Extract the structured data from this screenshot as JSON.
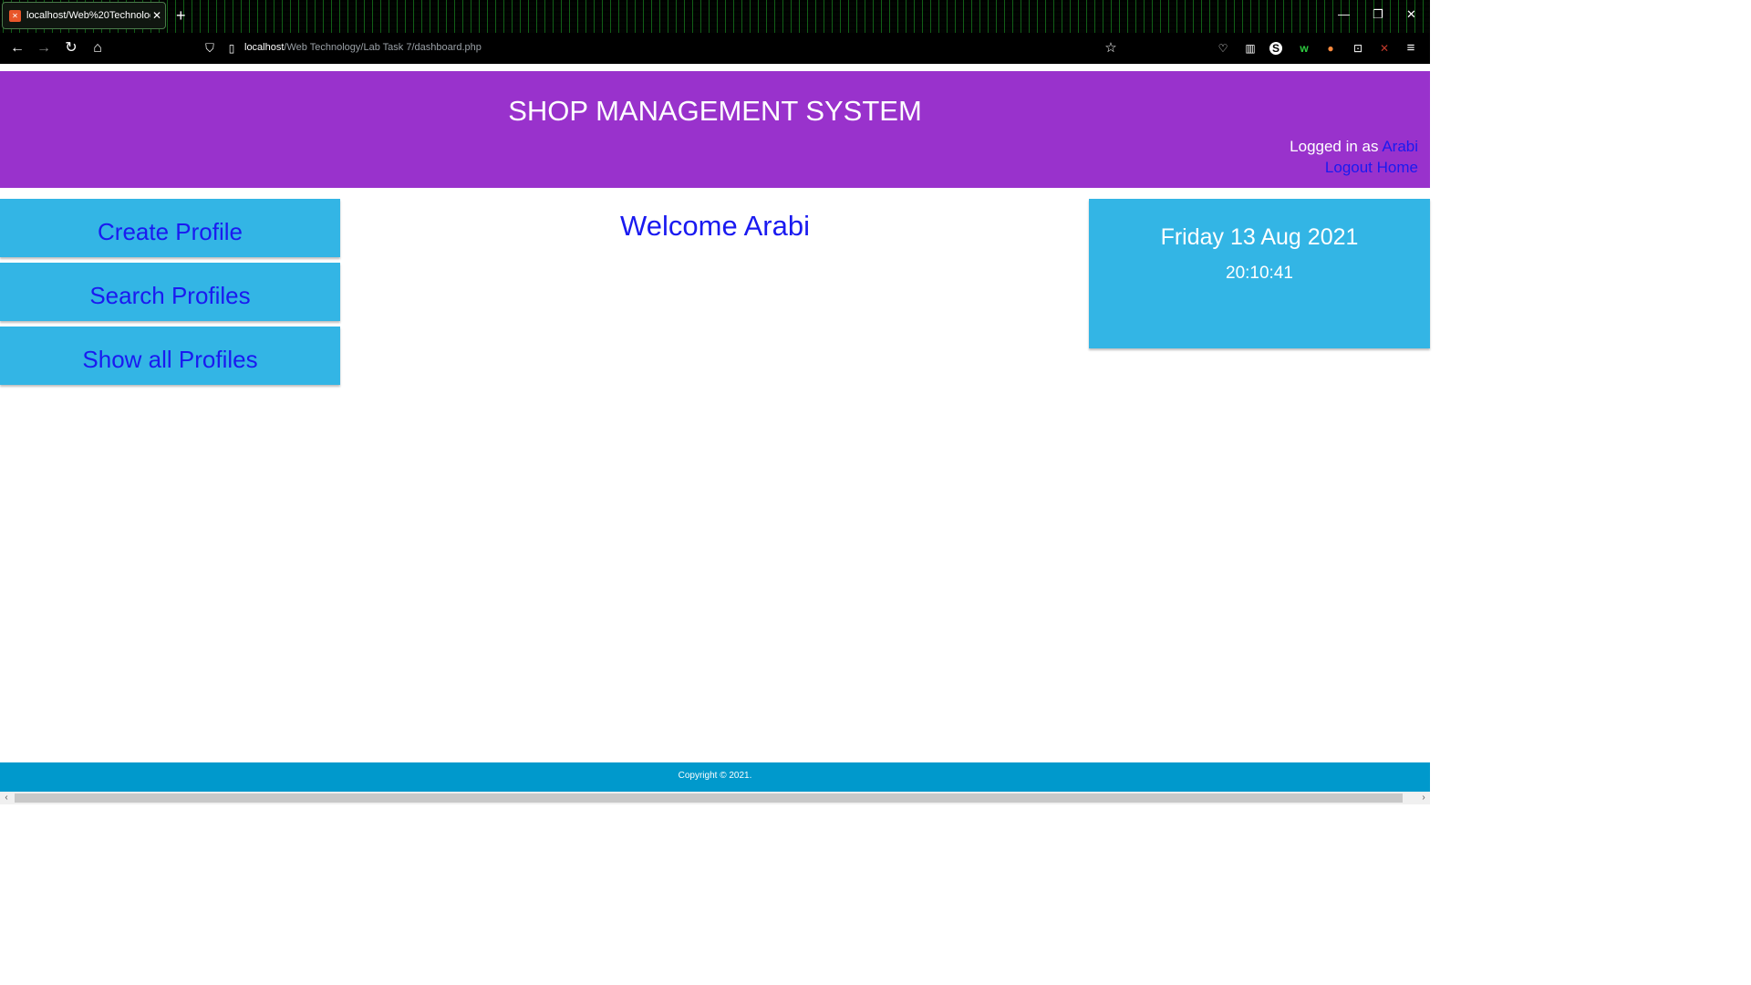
{
  "browser": {
    "tab_title": "localhost/Web%20Technology/Lab",
    "tab_favicon": "xampp-icon",
    "url_host": "localhost",
    "url_path": "/Web Technology/Lab Task 7/dashboard.php"
  },
  "header": {
    "title": "SHOP MANAGEMENT SYSTEM",
    "logged_in_prefix": "Logged in as ",
    "username": "Arabi",
    "logout_label": "Logout",
    "home_label": "Home"
  },
  "sidebar": {
    "items": [
      {
        "label": "Create Profile"
      },
      {
        "label": "Search Profiles"
      },
      {
        "label": "Show all Profiles"
      }
    ]
  },
  "main": {
    "welcome": "Welcome Arabi"
  },
  "clock": {
    "date": "Friday 13 Aug 2021",
    "time": "20:10:41"
  },
  "footer": {
    "copyright": "Copyright © 2021."
  },
  "colors": {
    "header_bg": "#9932cc",
    "panel_bg": "#33b5e5",
    "link": "#1a1af0",
    "footer_bg": "#0099cc"
  }
}
